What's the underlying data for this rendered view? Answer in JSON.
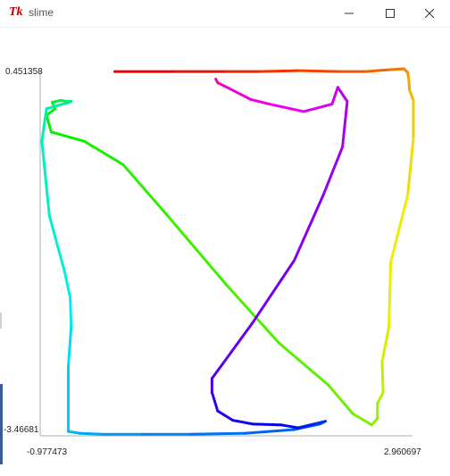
{
  "window": {
    "icon": "tk-feather-icon",
    "icon_text": "Tk",
    "title": "slime",
    "controls": [
      "minimize-icon",
      "maximize-icon",
      "close-icon"
    ]
  },
  "plot": {
    "y_max_label": "0.451358",
    "y_min_label": "-3.46681",
    "x_min_label": "-0.977473",
    "x_max_label": "2.960697"
  },
  "chart_data": {
    "type": "line",
    "xlim": [
      -0.977473,
      2.960697
    ],
    "ylim": [
      -3.46681,
      0.451358
    ],
    "grid": false,
    "colormap": "rainbow (red → magenta along path)",
    "x": [
      -0.19,
      0.45,
      0.99,
      1.34,
      1.76,
      2.18,
      2.47,
      2.71,
      2.87,
      2.91,
      2.92,
      2.93,
      2.97,
      2.97,
      2.91,
      2.73,
      2.71,
      2.64,
      2.65,
      2.59,
      2.59,
      2.53,
      2.33,
      2.07,
      1.55,
      0.99,
      0.37,
      -0.1,
      -0.51,
      -0.86,
      -0.91,
      -0.82,
      -0.85,
      -0.76,
      -0.7,
      -0.65,
      -0.69,
      -0.67,
      -0.74,
      -0.91,
      -0.96,
      -0.88,
      -0.72,
      -0.66,
      -0.65,
      -0.68,
      -0.68,
      -0.56,
      -0.33,
      0.11,
      0.62,
      1.19,
      1.71,
      1.98,
      2.04,
      1.92,
      1.75,
      1.57,
      1.27,
      1.06,
      0.9,
      0.84,
      0.84,
      0.97,
      1.27,
      1.71,
      2.02,
      2.22,
      2.27,
      2.17,
      2.11,
      1.81,
      1.45,
      1.25,
      1.02,
      0.9,
      0.88
    ],
    "y": [
      0.45,
      0.45,
      0.45,
      0.45,
      0.46,
      0.45,
      0.45,
      0.47,
      0.48,
      0.44,
      0.38,
      0.25,
      0.14,
      -0.27,
      -0.88,
      -1.6,
      -2.3,
      -2.67,
      -3.0,
      -3.12,
      -3.28,
      -3.35,
      -3.23,
      -2.92,
      -2.47,
      -1.84,
      -1.1,
      -0.55,
      -0.3,
      -0.2,
      -0.02,
      0.05,
      0.12,
      0.14,
      0.13,
      0.13,
      0.13,
      0.12,
      0.1,
      0.05,
      -0.3,
      -1.1,
      -1.7,
      -1.98,
      -2.3,
      -2.72,
      -3.42,
      -3.44,
      -3.45,
      -3.45,
      -3.45,
      -3.44,
      -3.4,
      -3.34,
      -3.31,
      -3.34,
      -3.38,
      -3.35,
      -3.34,
      -3.3,
      -3.2,
      -3.0,
      -2.85,
      -2.67,
      -2.25,
      -1.58,
      -0.87,
      -0.36,
      0.13,
      0.28,
      0.1,
      0.02,
      0.1,
      0.15,
      0.27,
      0.33,
      0.37
    ]
  }
}
